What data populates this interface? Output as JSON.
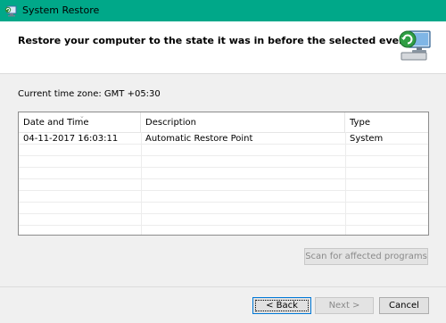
{
  "window": {
    "title": "System Restore"
  },
  "header": {
    "title": "Restore your computer to the state it was in before the selected event"
  },
  "timezone": "Current time zone: GMT +05:30",
  "table": {
    "columns": [
      "Date and Time",
      "Description",
      "Type"
    ],
    "rows": [
      {
        "date": "04-11-2017 16:03:11",
        "description": "Automatic Restore Point",
        "type": "System"
      }
    ]
  },
  "buttons": {
    "scan": "Scan for affected programs",
    "back": "< Back",
    "next": "Next >",
    "cancel": "Cancel"
  },
  "colors": {
    "titlebar": "#00a889",
    "accent": "#0078d7"
  }
}
